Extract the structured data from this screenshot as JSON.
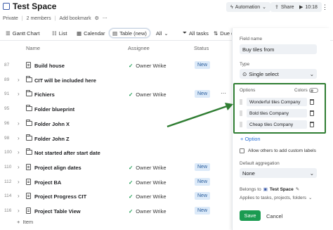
{
  "header": {
    "title": "Test Space",
    "privacy": "Private",
    "members": "2 members",
    "add_bookmark": "Add bookmark",
    "automation": "Automation",
    "share": "Share",
    "timer": "10:18"
  },
  "views": {
    "gantt": "Gantt Chart",
    "list": "List",
    "calendar": "Calendar",
    "table": "Table (new)",
    "all": "All",
    "filter": "All tasks",
    "due": "Due d"
  },
  "columns": {
    "name": "Name",
    "assignee": "Assignee",
    "status": "Status"
  },
  "rows": [
    {
      "num": "87",
      "name": "Build house",
      "assignee": "Owner Wrike",
      "status": "New",
      "type": "doc",
      "chev": ""
    },
    {
      "num": "89",
      "name": "CIT will be included here",
      "assignee": "",
      "status": "",
      "type": "fld",
      "chev": "›"
    },
    {
      "num": "91",
      "name": "Fichiers",
      "assignee": "Owner Wrike",
      "status": "New",
      "type": "fld",
      "chev": "›"
    },
    {
      "num": "95",
      "name": "Folder blueprint",
      "assignee": "",
      "status": "",
      "type": "fld",
      "chev": ""
    },
    {
      "num": "96",
      "name": "Folder John X",
      "assignee": "",
      "status": "",
      "type": "fld",
      "chev": "›"
    },
    {
      "num": "98",
      "name": "Folder John Z",
      "assignee": "",
      "status": "",
      "type": "fld",
      "chev": "›"
    },
    {
      "num": "100",
      "name": "Not started after start date",
      "assignee": "",
      "status": "",
      "type": "fld",
      "chev": "›"
    },
    {
      "num": "110",
      "name": "Project align dates",
      "assignee": "Owner Wrike",
      "status": "New",
      "type": "doc",
      "chev": "›"
    },
    {
      "num": "112",
      "name": "Project BA",
      "assignee": "Owner Wrike",
      "status": "New",
      "type": "doc",
      "chev": "›"
    },
    {
      "num": "114",
      "name": "Project Progress CIT",
      "assignee": "Owner Wrike",
      "status": "New",
      "type": "doc",
      "chev": "›"
    },
    {
      "num": "116",
      "name": "Project Table View",
      "assignee": "Owner Wrike",
      "status": "New",
      "type": "doc",
      "chev": "›"
    }
  ],
  "add_item": "Item",
  "panel": {
    "field_name_label": "Field name",
    "field_name_value": "Buy tiles from",
    "type_label": "Type",
    "type_value": "Single select",
    "options_label": "Options",
    "colors_label": "Colors",
    "options": [
      "Wonderful tiles Company",
      "Bold tiles Company",
      "Cheap tiles Company"
    ],
    "add_option": "+ Option",
    "allow_custom": "Allow others to add custom labels",
    "aggregation_label": "Default aggregation",
    "aggregation_value": "None",
    "belongs_label": "Belongs to",
    "belongs_value": "Test Space",
    "applies": "Applies to tasks, projects, folders",
    "save": "Save",
    "cancel": "Cancel"
  },
  "accent_colors": {
    "green": "#1a9b51",
    "annotation": "#2f7d32",
    "badge": "#dceaf9"
  }
}
